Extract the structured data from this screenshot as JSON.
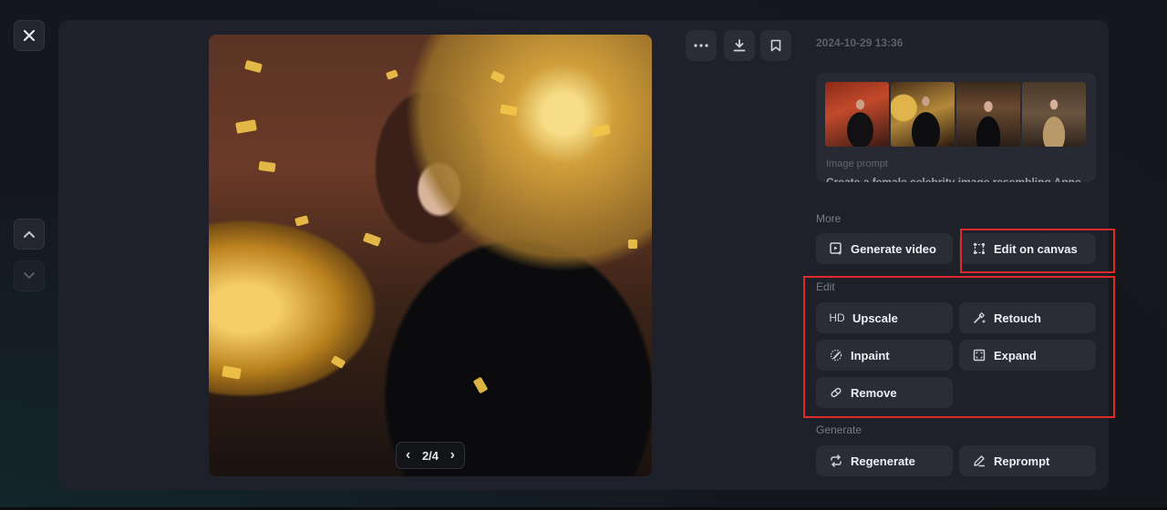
{
  "nav": {
    "close_icon": "close-icon",
    "up_icon": "chevron-up-icon",
    "down_icon": "chevron-down-icon"
  },
  "viewer": {
    "pager": {
      "current": 2,
      "total": 4,
      "text": "2/4",
      "prev": "‹",
      "next": "›"
    }
  },
  "toolbar": {
    "more_icon": "more-horizontal-icon",
    "download_icon": "download-icon",
    "bookmark_icon": "bookmark-icon"
  },
  "details": {
    "timestamp": "2024-10-29 13:36",
    "prompt_label": "Image prompt",
    "prompt_text": "Create a female celebrity image resembling Anne",
    "thumbnails": [
      "thumbnail-1",
      "thumbnail-2",
      "thumbnail-3",
      "thumbnail-4"
    ]
  },
  "sections": {
    "more": {
      "label": "More",
      "buttons": [
        {
          "label": "Generate video",
          "icon": "video-plus-icon"
        },
        {
          "label": "Edit on canvas",
          "icon": "canvas-icon"
        }
      ]
    },
    "edit": {
      "label": "Edit",
      "buttons": [
        {
          "label": "Upscale",
          "icon": "HD"
        },
        {
          "label": "Retouch",
          "icon": "magic-wand-icon"
        },
        {
          "label": "Inpaint",
          "icon": "brush-icon"
        },
        {
          "label": "Expand",
          "icon": "expand-icon"
        },
        {
          "label": "Remove",
          "icon": "eraser-icon"
        }
      ]
    },
    "generate": {
      "label": "Generate",
      "buttons": [
        {
          "label": "Regenerate",
          "icon": "repeat-icon"
        },
        {
          "label": "Reprompt",
          "icon": "pencil-icon"
        }
      ]
    }
  },
  "colors": {
    "panel_bg": "#1e2129",
    "button_bg": "#2a2d36",
    "highlight": "#e02a2a"
  }
}
